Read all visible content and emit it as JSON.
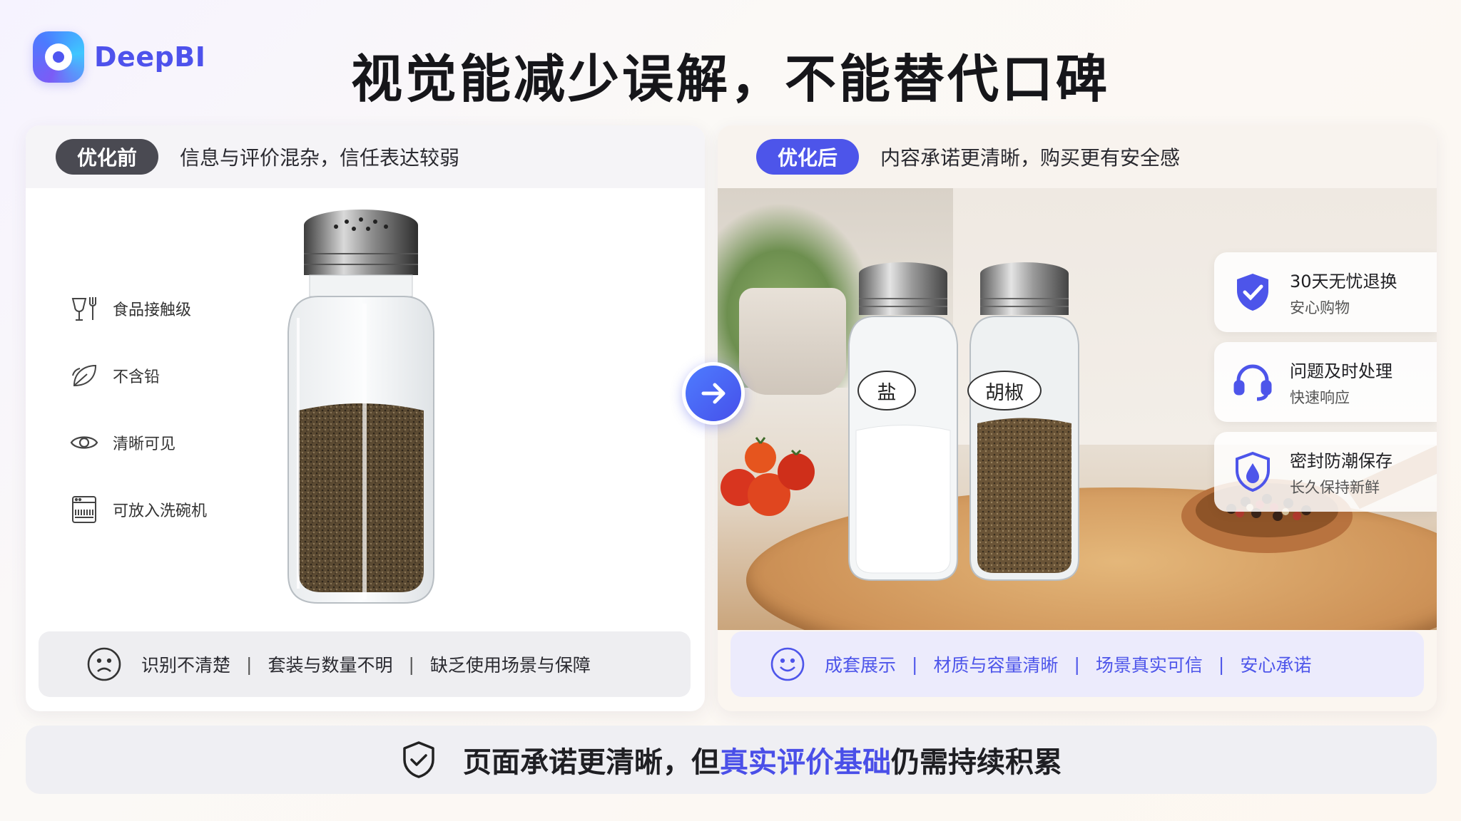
{
  "logo": {
    "text": "DeepBI"
  },
  "title": "视觉能减少误解，不能替代口碑",
  "left_panel": {
    "pill": "优化前",
    "header": "信息与评价混杂，信任表达较弱",
    "features": [
      {
        "icon": "food-grade-icon",
        "label": "食品接触级"
      },
      {
        "icon": "leaf-icon",
        "label": "不含铅"
      },
      {
        "icon": "eye-icon",
        "label": "清晰可见"
      },
      {
        "icon": "dishwasher-icon",
        "label": "可放入洗碗机"
      }
    ],
    "bottom_bar": {
      "icon": "sad-face-icon",
      "items": [
        "识别不清楚",
        "套装与数量不明",
        "缺乏使用场景与保障"
      ],
      "separator": "|"
    }
  },
  "right_panel": {
    "pill": "优化后",
    "header": "内容承诺更清晰，购买更有安全感",
    "jar_labels": [
      "盐",
      "胡椒"
    ],
    "badges": [
      {
        "icon": "shield-check-icon",
        "title": "30天无忧退换",
        "sub": "安心购物"
      },
      {
        "icon": "headset-icon",
        "title": "问题及时处理",
        "sub": "快速响应"
      },
      {
        "icon": "drop-shield-icon",
        "title": "密封防潮保存",
        "sub": "长久保持新鲜"
      }
    ],
    "bottom_bar": {
      "icon": "smile-face-icon",
      "items": [
        "成套展示",
        "材质与容量清晰",
        "场景真实可信",
        "安心承诺"
      ],
      "separator": "|"
    }
  },
  "footer": {
    "icon": "shield-check-outline-icon",
    "text_before": "页面承诺更清晰，但",
    "highlight": "真实评价基础",
    "text_after": "仍需持续积累"
  },
  "colors": {
    "accent": "#4d55ea",
    "dark_pill": "#4a4a52"
  }
}
